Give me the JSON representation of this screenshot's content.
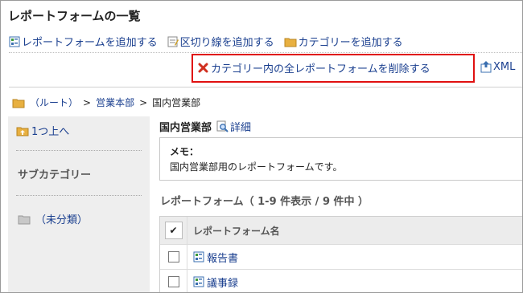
{
  "page": {
    "title": "レポートフォームの一覧"
  },
  "toolbar": {
    "add_form": "レポートフォームを追加する",
    "add_separator": "区切り線を追加する",
    "add_category": "カテゴリーを追加する",
    "delete_all": "カテゴリー内の全レポートフォームを削除する",
    "xml": "XML"
  },
  "breadcrumb": {
    "root": "（ルート）",
    "sep1": ">",
    "dept": "営業本部",
    "sep2": ">",
    "current": "国内営業部"
  },
  "sidebar": {
    "up": "1つ上へ",
    "subcategory_label": "サブカテゴリー",
    "uncategorized": "（未分類）"
  },
  "main": {
    "category_name": "国内営業部",
    "detail": "詳細",
    "memo_label": "メモ：",
    "memo_text": "国内営業部用のレポートフォームです。",
    "list_title": "レポートフォーム（ 1-9 件表示 / 9 件中 ）",
    "column_name": "レポートフォーム名",
    "header_check": "✔",
    "rows": [
      {
        "name": "報告書"
      },
      {
        "name": "議事録"
      }
    ]
  },
  "colors": {
    "link": "#1a3f8f",
    "highlight": "#e01010",
    "folder": "#e8b040"
  }
}
